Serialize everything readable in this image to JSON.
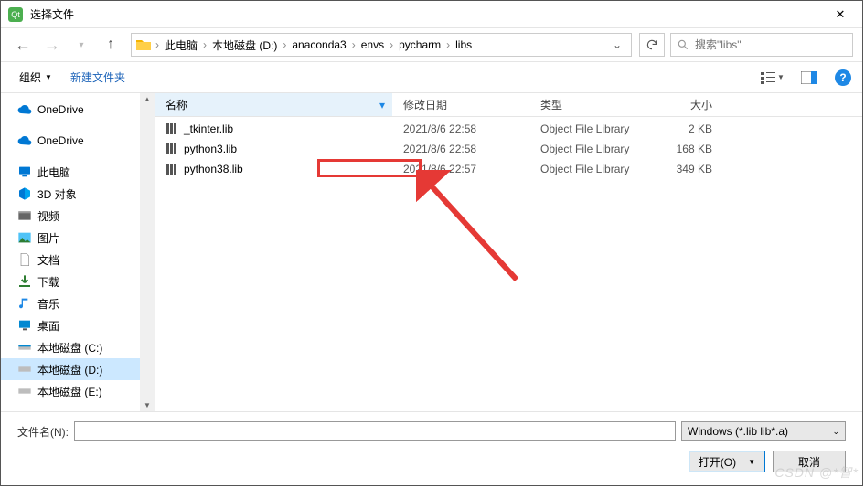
{
  "window": {
    "title": "选择文件"
  },
  "breadcrumbs": {
    "root": "此电脑",
    "drive": "本地磁盘 (D:)",
    "p1": "anaconda3",
    "p2": "envs",
    "p3": "pycharm",
    "p4": "libs"
  },
  "search": {
    "placeholder": "搜索\"libs\""
  },
  "toolbar": {
    "organize": "组织",
    "newfolder": "新建文件夹"
  },
  "columns": {
    "name": "名称",
    "date": "修改日期",
    "type": "类型",
    "size": "大小"
  },
  "sidebar": {
    "onedrive1": "OneDrive",
    "onedrive2": "OneDrive",
    "thispc": "此电脑",
    "objects3d": "3D 对象",
    "videos": "视频",
    "pictures": "图片",
    "documents": "文档",
    "downloads": "下载",
    "music": "音乐",
    "desktop": "桌面",
    "drivec": "本地磁盘 (C:)",
    "drived": "本地磁盘 (D:)",
    "drivee": "本地磁盘 (E:)"
  },
  "files": [
    {
      "name": "_tkinter.lib",
      "date": "2021/8/6 22:58",
      "type": "Object File Library",
      "size": "2 KB"
    },
    {
      "name": "python3.lib",
      "date": "2021/8/6 22:58",
      "type": "Object File Library",
      "size": "168 KB"
    },
    {
      "name": "python38.lib",
      "date": "2021/8/6 22:57",
      "type": "Object File Library",
      "size": "349 KB"
    }
  ],
  "footer": {
    "filename_label": "文件名(N):",
    "filter": "Windows (*.lib lib*.a)",
    "open": "打开(O)",
    "cancel": "取消"
  },
  "watermark": "CSDN @*智*"
}
